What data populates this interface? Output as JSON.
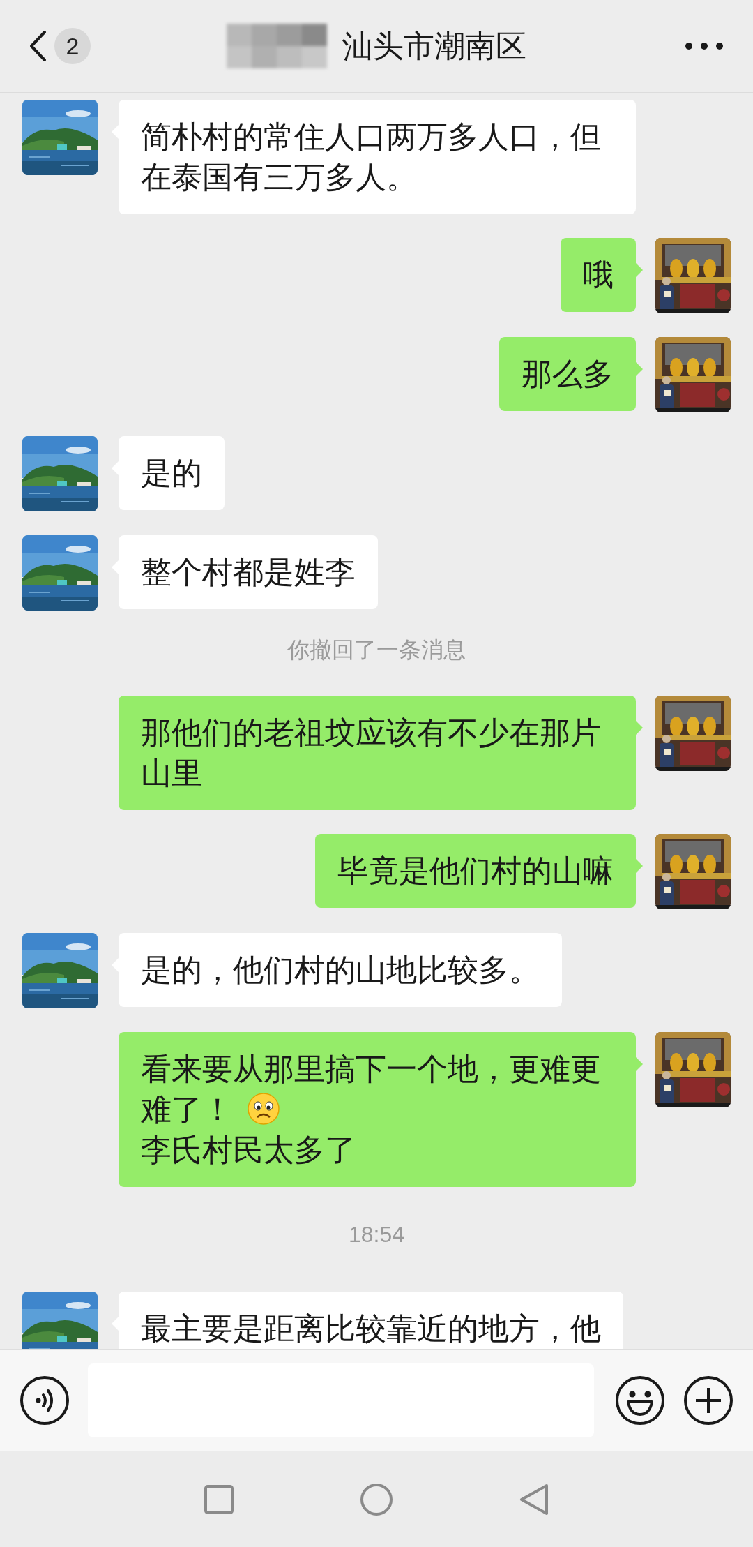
{
  "header": {
    "back_badge": "2",
    "title": "汕头市潮南区"
  },
  "messages": [
    {
      "kind": "received",
      "segments": [
        {
          "kind": "text",
          "text": "简朴村的常住人口两万多人口，但在泰国有三万多人。"
        }
      ]
    },
    {
      "kind": "sent",
      "segments": [
        {
          "kind": "text",
          "text": "哦"
        }
      ]
    },
    {
      "kind": "sent",
      "segments": [
        {
          "kind": "text",
          "text": "那么多"
        }
      ]
    },
    {
      "kind": "received",
      "segments": [
        {
          "kind": "text",
          "text": "是的"
        }
      ]
    },
    {
      "kind": "received",
      "segments": [
        {
          "kind": "text",
          "text": "整个村都是姓李"
        }
      ]
    },
    {
      "kind": "system",
      "text": "你撤回了一条消息"
    },
    {
      "kind": "sent",
      "segments": [
        {
          "kind": "text",
          "text": "那他们的老祖坟应该有不少在那片山里"
        }
      ]
    },
    {
      "kind": "sent",
      "segments": [
        {
          "kind": "text",
          "text": "毕竟是他们村的山嘛"
        }
      ]
    },
    {
      "kind": "received",
      "segments": [
        {
          "kind": "text",
          "text": "是的，他们村的山地比较多。"
        }
      ]
    },
    {
      "kind": "sent",
      "segments": [
        {
          "kind": "text",
          "text": "看来要从那里搞下一个地，更难更难了！"
        },
        {
          "kind": "emoji"
        },
        {
          "kind": "break"
        },
        {
          "kind": "text",
          "text": "李氏村民太多了"
        }
      ]
    },
    {
      "kind": "time",
      "text": "18:54"
    },
    {
      "kind": "received",
      "segments": [
        {
          "kind": "text",
          "text": "最主要是距离比较靠近的地方，他"
        }
      ]
    }
  ]
}
